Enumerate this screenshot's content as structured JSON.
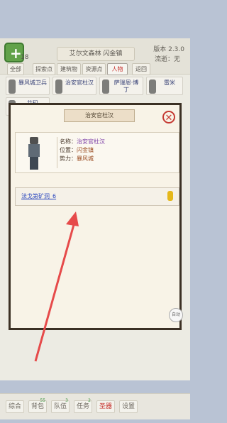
{
  "top": {
    "level": "18",
    "location": "艾尔文森林 闪金镇",
    "version": "版本 2.3.0",
    "weather": "流逝：无"
  },
  "tabs": [
    {
      "label": "全部"
    },
    {
      "label": "探索点"
    },
    {
      "label": "建筑物"
    },
    {
      "label": "资源点"
    },
    {
      "label": "人物"
    },
    {
      "label": "返回"
    }
  ],
  "npcs": [
    {
      "label": "暴风城卫兵"
    },
    {
      "label": "治安官杜汉"
    },
    {
      "label": "萨瑞恩·博丁"
    },
    {
      "label": "雷米"
    },
    {
      "label": "艾玛"
    }
  ],
  "modal": {
    "title": "治安官杜汉",
    "name_label": "名称：",
    "name_value": "治安官杜汉",
    "position_label": "位置：",
    "position_value": "闪金镇",
    "faction_label": "势力：",
    "faction_value": "暴风城",
    "quest": "法戈第矿洞_6"
  },
  "bottom_nav": [
    {
      "label": "综合"
    },
    {
      "label": "背包",
      "badge": "55"
    },
    {
      "label": "队伍",
      "badge": "3"
    },
    {
      "label": "任务",
      "badge": "2"
    },
    {
      "label": "圣器"
    },
    {
      "label": "设置"
    }
  ],
  "auto_label": "自动"
}
